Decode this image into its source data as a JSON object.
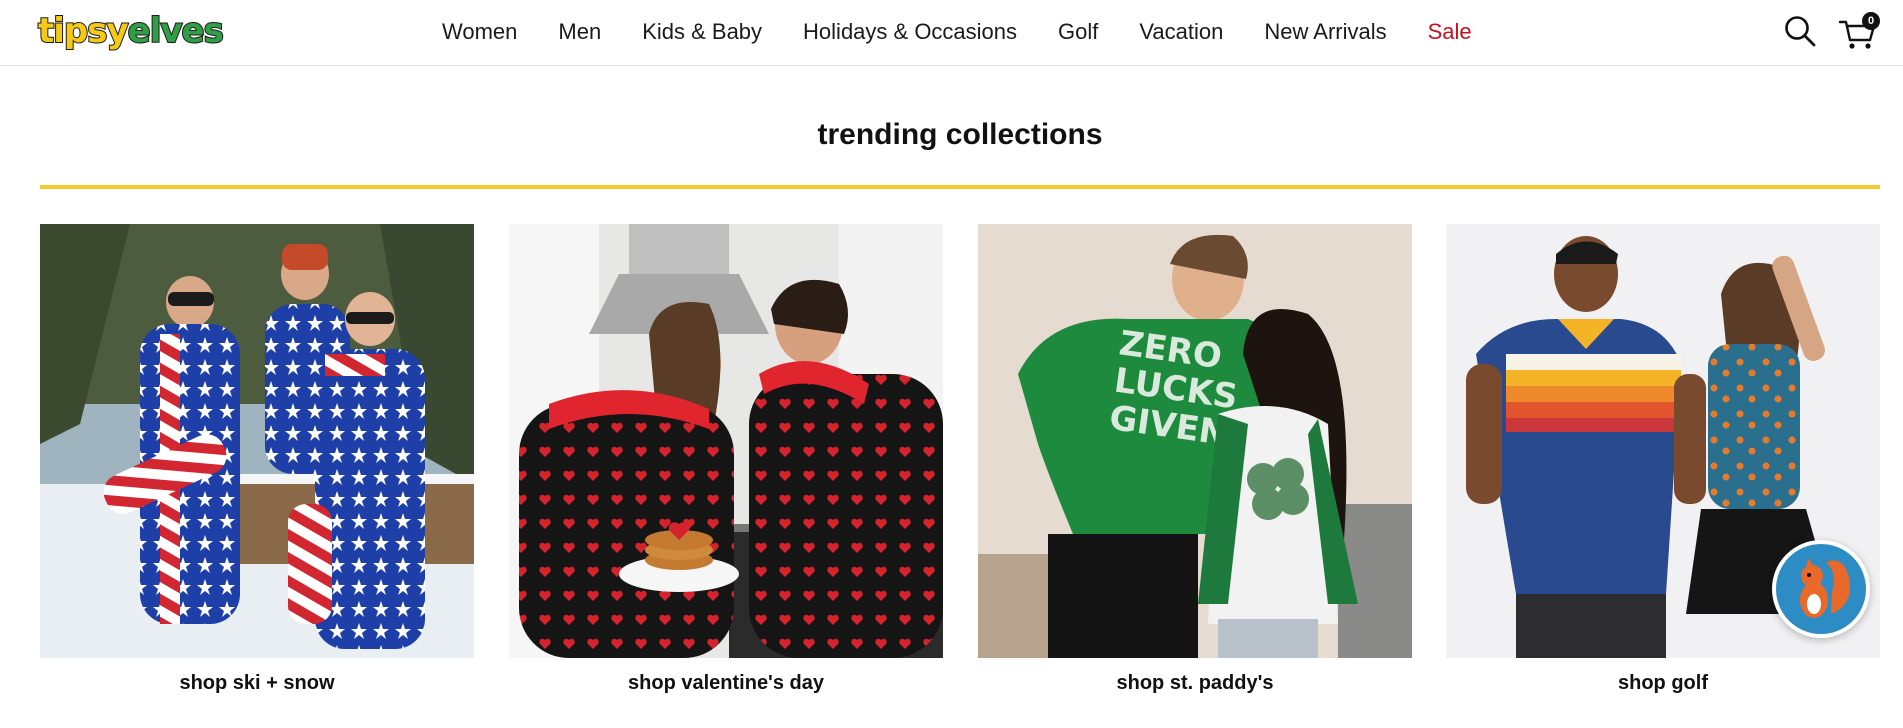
{
  "header": {
    "logo": {
      "part1": "tipsy",
      "part2": "elves"
    },
    "nav": [
      {
        "label": "Women"
      },
      {
        "label": "Men"
      },
      {
        "label": "Kids & Baby"
      },
      {
        "label": "Holidays & Occasions"
      },
      {
        "label": "Golf"
      },
      {
        "label": "Vacation"
      },
      {
        "label": "New Arrivals"
      },
      {
        "label": "Sale"
      }
    ],
    "search_icon": "search-icon",
    "cart_icon": "cart-icon",
    "cart_count": "0"
  },
  "section": {
    "title": "trending collections",
    "accent_color": "#f5cc2a",
    "collections": [
      {
        "label": "shop ski + snow",
        "image": "ski-snow-photo"
      },
      {
        "label": "shop valentine's day",
        "image": "valentines-photo"
      },
      {
        "label": "shop st. paddy's",
        "image": "st-paddys-photo"
      },
      {
        "label": "shop golf",
        "image": "golf-photo"
      }
    ]
  },
  "chat_widget": {
    "icon": "squirrel-chat-icon",
    "color": "#2e8cc4"
  },
  "colors": {
    "sale": "#c4121f",
    "brand_yellow": "#f6c914",
    "brand_green": "#2f9e45"
  }
}
